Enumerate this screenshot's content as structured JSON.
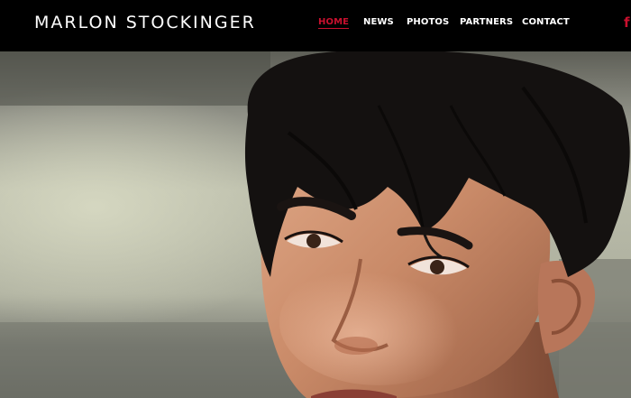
{
  "header": {
    "site_title": "MARLON STOCKINGER",
    "nav": [
      {
        "label": "HOME",
        "active": true
      },
      {
        "label": "NEWS",
        "active": false
      },
      {
        "label": "PHOTOS",
        "active": false
      },
      {
        "label": "PARTNERS",
        "active": false
      },
      {
        "label": "CONTACT",
        "active": false
      }
    ],
    "social_icon": "f",
    "social_icon_name": "facebook-icon"
  },
  "colors": {
    "header_bg": "#000000",
    "title_text": "#ffffff",
    "nav_text": "#ffffff",
    "nav_active": "#c8102e",
    "social_icon": "#c8102e"
  },
  "hero": {
    "image_subject": "portrait-photo"
  }
}
